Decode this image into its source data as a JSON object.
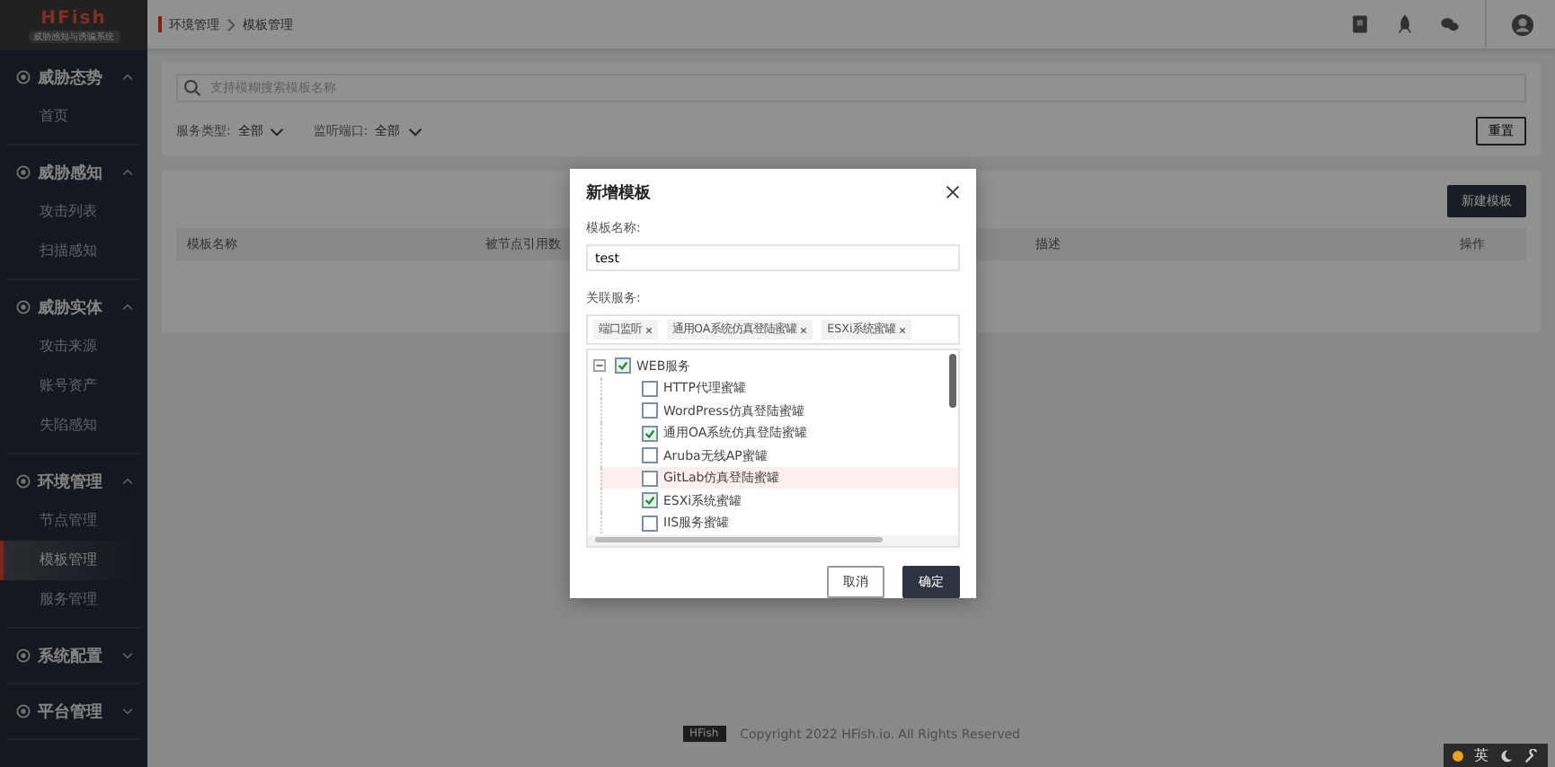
{
  "logo": {
    "name": "HFish",
    "subtitle": "威胁感知与诱骗系统"
  },
  "sidebar": {
    "groups": [
      {
        "label": "威胁态势",
        "expanded": true,
        "items": [
          {
            "label": "首页",
            "selected": false
          }
        ]
      },
      {
        "label": "威胁感知",
        "expanded": true,
        "items": [
          {
            "label": "攻击列表",
            "selected": false
          },
          {
            "label": "扫描感知",
            "selected": false
          }
        ]
      },
      {
        "label": "威胁实体",
        "expanded": true,
        "items": [
          {
            "label": "攻击来源",
            "selected": false
          },
          {
            "label": "账号资产",
            "selected": false
          },
          {
            "label": "失陷感知",
            "selected": false
          }
        ]
      },
      {
        "label": "环境管理",
        "expanded": true,
        "items": [
          {
            "label": "节点管理",
            "selected": false
          },
          {
            "label": "模板管理",
            "selected": true
          },
          {
            "label": "服务管理",
            "selected": false
          }
        ]
      },
      {
        "label": "系统配置",
        "expanded": false
      },
      {
        "label": "平台管理",
        "expanded": false
      }
    ]
  },
  "breadcrumb": [
    "环境管理",
    "模板管理"
  ],
  "filters": {
    "search": {
      "placeholder": "支持模糊搜索模板名称"
    },
    "selects": [
      {
        "label": "服务类型:",
        "value": "全部"
      },
      {
        "label": "监听端口:",
        "value": "全部"
      }
    ],
    "reset_button": "重置"
  },
  "table": {
    "new_button": "新建模板",
    "columns": [
      "模板名称",
      "被节点引用数",
      "描述",
      "操作"
    ]
  },
  "footer": {
    "badge": "HFish",
    "copyright": "Copyright 2022 HFish.io. All Rights Reserved"
  },
  "ime_bar": {
    "label": "英"
  },
  "dialog": {
    "title": "新增模板",
    "name_label": "模板名称:",
    "name_value": "test",
    "services_label": "关联服务:",
    "tags": [
      "端口监听",
      "通用OA系统仿真登陆蜜罐",
      "ESXi系统蜜罐"
    ],
    "tree": {
      "label": "WEB服务",
      "checked": true,
      "expanded": true,
      "children": [
        {
          "label": "HTTP代理蜜罐",
          "checked": false,
          "hovered": false
        },
        {
          "label": "WordPress仿真登陆蜜罐",
          "checked": false,
          "hovered": false
        },
        {
          "label": "通用OA系统仿真登陆蜜罐",
          "checked": true,
          "hovered": false
        },
        {
          "label": "Aruba无线AP蜜罐",
          "checked": false,
          "hovered": false
        },
        {
          "label": "GitLab仿真登陆蜜罐",
          "checked": false,
          "hovered": true
        },
        {
          "label": "ESXi系统蜜罐",
          "checked": true,
          "hovered": false
        },
        {
          "label": "IIS服务蜜罐",
          "checked": false,
          "hovered": false
        }
      ]
    },
    "buttons": [
      {
        "label": "取消",
        "kind": "secondary"
      },
      {
        "label": "确定",
        "kind": "primary"
      }
    ]
  }
}
